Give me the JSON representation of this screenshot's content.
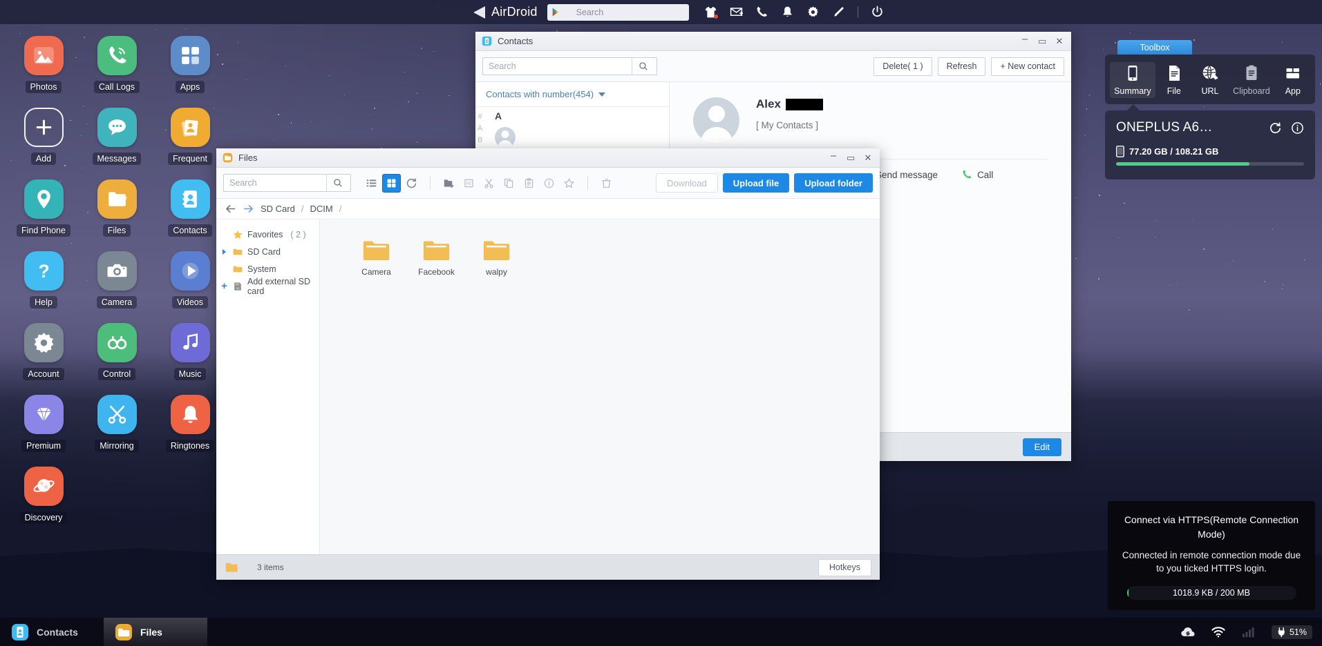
{
  "topbar": {
    "brand": "AirDroid",
    "search_placeholder": "Search",
    "search_value": "",
    "icons": [
      {
        "name": "tshirt-icon",
        "label": "Themes"
      },
      {
        "name": "mail-icon",
        "label": "Mail"
      },
      {
        "name": "phone-icon",
        "label": "Phone"
      },
      {
        "name": "bell-icon",
        "label": "Notifications"
      },
      {
        "name": "gear-icon",
        "label": "Settings"
      },
      {
        "name": "pen-icon",
        "label": "Edit"
      },
      {
        "name": "power-icon",
        "label": "Power"
      }
    ]
  },
  "desktop": {
    "icons": [
      {
        "label": "Photos",
        "icon": "photos-icon",
        "color": "#ef6a4e"
      },
      {
        "label": "Call Logs",
        "icon": "call-logs-icon",
        "color": "#4bbd7e"
      },
      {
        "label": "Apps",
        "icon": "apps-icon",
        "color": "#5d8cc9"
      },
      {
        "label": "Add",
        "icon": "add-icon",
        "color": "transparent"
      },
      {
        "label": "Messages",
        "icon": "messages-icon",
        "color": "#3fb4bd"
      },
      {
        "label": "Frequent",
        "icon": "frequent-icon",
        "color": "#f0ab32"
      },
      {
        "label": "Find Phone",
        "icon": "find-phone-icon",
        "color": "#35b4b7"
      },
      {
        "label": "Files",
        "icon": "files-icon",
        "color": "#edae3d"
      },
      {
        "label": "Contacts",
        "icon": "contacts-icon",
        "color": "#41bdf2"
      },
      {
        "label": "Help",
        "icon": "help-icon",
        "color": "#41bdf2"
      },
      {
        "label": "Camera",
        "icon": "camera-icon",
        "color": "#7b8793"
      },
      {
        "label": "Videos",
        "icon": "videos-icon",
        "color": "#5b7fd0"
      },
      {
        "label": "Account",
        "icon": "account-icon",
        "color": "#7b8793"
      },
      {
        "label": "Control",
        "icon": "control-icon",
        "color": "#4dbd7c"
      },
      {
        "label": "Music",
        "icon": "music-icon",
        "color": "#6f6bd6"
      },
      {
        "label": "Premium",
        "icon": "premium-icon",
        "color": "#8b85e8"
      },
      {
        "label": "Mirroring",
        "icon": "mirroring-icon",
        "color": "#3fb5f0"
      },
      {
        "label": "Ringtones",
        "icon": "ringtones-icon",
        "color": "#ef6345"
      },
      {
        "label": "Discovery",
        "icon": "discovery-icon",
        "color": "#ef6345"
      }
    ]
  },
  "contacts_window": {
    "title": "Contacts",
    "search_placeholder": "Search",
    "search_value": "",
    "delete_label": "Delete( 1 )",
    "refresh_label": "Refresh",
    "new_contact_label": "+ New contact",
    "filter_label": "Contacts with number(454)",
    "alpha_index": [
      "#",
      "A",
      "B"
    ],
    "section_header": "A",
    "profile": {
      "name": "Alex",
      "group": "[ My Contacts ]",
      "send_message_label": "Send message",
      "call_label": "Call"
    },
    "edit_label": "Edit",
    "window_buttons": {
      "minimize": "–",
      "maximize": "▭",
      "close": "✕"
    }
  },
  "files_window": {
    "title": "Files",
    "search_placeholder": "Search",
    "search_value": "",
    "toolbar_icons": [
      {
        "name": "list-view-icon",
        "label": "List view"
      },
      {
        "name": "grid-view-icon",
        "label": "Grid view",
        "active": true
      },
      {
        "name": "refresh-icon",
        "label": "Refresh"
      },
      {
        "name": "new-folder-icon",
        "label": "New folder"
      },
      {
        "name": "rename-icon",
        "label": "Rename"
      },
      {
        "name": "cut-icon",
        "label": "Cut"
      },
      {
        "name": "copy-icon",
        "label": "Copy"
      },
      {
        "name": "paste-icon",
        "label": "Paste"
      },
      {
        "name": "info-icon",
        "label": "Info"
      },
      {
        "name": "favorite-icon",
        "label": "Favorite"
      },
      {
        "name": "delete-icon",
        "label": "Delete"
      }
    ],
    "download_label": "Download",
    "upload_file_label": "Upload file",
    "upload_folder_label": "Upload folder",
    "breadcrumb": [
      "SD Card",
      "DCIM"
    ],
    "tree": [
      {
        "label": "Favorites",
        "count": "( 2 )",
        "icon": "star-icon",
        "twisty": "none"
      },
      {
        "label": "SD Card",
        "count": "",
        "icon": "folder-icon",
        "twisty": "collapsed"
      },
      {
        "label": "System",
        "count": "",
        "icon": "folder-icon",
        "twisty": "none"
      },
      {
        "label": "Add external SD card",
        "count": "",
        "icon": "sdcard-icon",
        "twisty": "plus"
      }
    ],
    "items": [
      {
        "name": "Camera",
        "type": "folder"
      },
      {
        "name": "Facebook",
        "type": "folder"
      },
      {
        "name": "walpy",
        "type": "folder"
      }
    ],
    "status_count": "3 items",
    "hotkeys_label": "Hotkeys",
    "window_buttons": {
      "minimize": "–",
      "maximize": "▭",
      "close": "✕"
    }
  },
  "toolbox": {
    "tab_label": "Toolbox",
    "tabs": [
      {
        "label": "Summary",
        "icon": "phone-outline-icon",
        "selected": true
      },
      {
        "label": "File",
        "icon": "file-icon",
        "selected": false
      },
      {
        "label": "URL",
        "icon": "globe-link-icon",
        "selected": false
      },
      {
        "label": "Clipboard",
        "icon": "clipboard-icon",
        "selected": false
      },
      {
        "label": "App",
        "icon": "app-box-icon",
        "selected": false
      }
    ],
    "device_name": "ONEPLUS A6…",
    "refresh_icon": "refresh-icon",
    "info_icon": "info-icon",
    "storage_text": "77.20 GB / 108.21 GB",
    "storage_percent": 71,
    "storage_bar_color": "#52cb8a"
  },
  "notification": {
    "title": "Connect via HTTPS(Remote Connection Mode)",
    "body": "Connected in remote connection mode due to you ticked HTTPS login.",
    "quota_text": "1018.9 KB / 200 MB",
    "quota_percent": 1
  },
  "taskbar": {
    "items": [
      {
        "label": "Contacts",
        "icon": "contacts-icon",
        "active": false
      },
      {
        "label": "Files",
        "icon": "files-icon",
        "active": true
      }
    ],
    "tray": [
      {
        "name": "cloud-link-icon"
      },
      {
        "name": "wifi-icon"
      },
      {
        "name": "signal-bars-icon"
      }
    ],
    "battery_label": "51%",
    "battery_icon": "plug-icon"
  }
}
